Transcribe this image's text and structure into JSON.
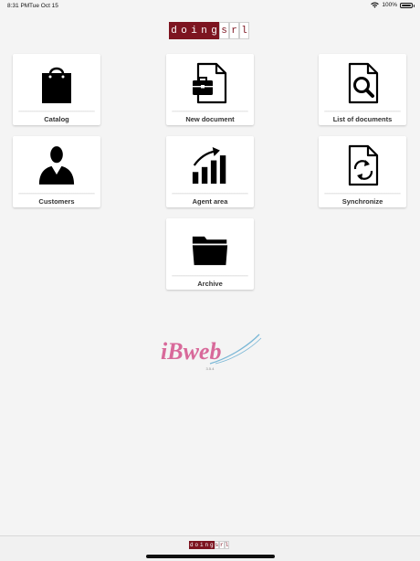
{
  "status_bar": {
    "time": "8:31 PM",
    "date": "Tue Oct 15",
    "battery": "100%",
    "battery_level": 1.0
  },
  "brand": {
    "logo_left": [
      "d",
      "o",
      "i",
      "n",
      "g"
    ],
    "logo_right": [
      "s",
      "r",
      "l"
    ],
    "logo_color": "#7d1420"
  },
  "tiles": [
    {
      "label": "Catalog",
      "icon": "shopping-bag-icon"
    },
    {
      "label": "New document",
      "icon": "new-document-icon"
    },
    {
      "label": "List of documents",
      "icon": "search-document-icon"
    },
    {
      "label": "Customers",
      "icon": "customer-icon"
    },
    {
      "label": "Agent area",
      "icon": "growth-chart-icon"
    },
    {
      "label": "Synchronize",
      "icon": "sync-document-icon"
    },
    {
      "label": "Archive",
      "icon": "folder-icon"
    }
  ],
  "app_logo": {
    "name": "iBweb",
    "version": "3.5.4",
    "colors": {
      "pink": "#d8699a",
      "blue": "#7ab7d6"
    }
  }
}
